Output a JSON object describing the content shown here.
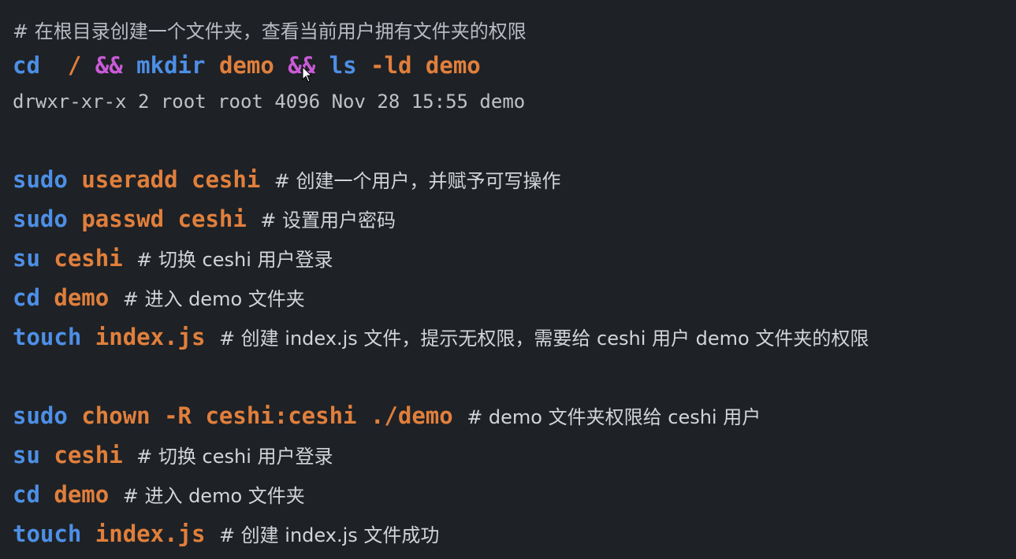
{
  "heading": "# 在根目录创建一个文件夹，查看当前用户拥有文件夹的权限",
  "line1": {
    "cmd1": "cd",
    "slash": "/",
    "op1": "&&",
    "cmd2": "mkdir",
    "arg1": "demo",
    "op2": "&&",
    "cmd3": "ls",
    "flag": "-ld",
    "arg2": "demo"
  },
  "output": "drwxr-xr-x 2 root root 4096 Nov 28 15:55 demo",
  "block1": [
    {
      "cmd": "sudo",
      "args": "useradd ceshi",
      "comment": "# 创建一个用户，并赋予可写操作"
    },
    {
      "cmd": "sudo",
      "args": "passwd ceshi",
      "comment": "# 设置用户密码"
    },
    {
      "cmd": "su",
      "args": "ceshi",
      "comment": "# 切换 ceshi 用户登录"
    },
    {
      "cmd": "cd",
      "args": "demo",
      "comment": "# 进入 demo 文件夹"
    },
    {
      "cmd": "touch",
      "args": "index.js",
      "comment": "# 创建 index.js 文件，提示无权限，需要给 ceshi 用户 demo 文件夹的权限"
    }
  ],
  "block2": [
    {
      "cmd": "sudo",
      "args": "chown -R ceshi:ceshi ./demo",
      "comment": "# demo 文件夹权限给 ceshi 用户"
    },
    {
      "cmd": "su",
      "args": "ceshi",
      "comment": "# 切换 ceshi 用户登录"
    },
    {
      "cmd": "cd",
      "args": "demo",
      "comment": "# 进入 demo 文件夹"
    },
    {
      "cmd": "touch",
      "args": "index.js",
      "comment": "# 创建 index.js 文件成功"
    }
  ],
  "icons": {
    "cursor": "mouse-pointer-icon"
  },
  "colors": {
    "background": "#1e2125",
    "command": "#4d8fe6",
    "argument": "#e07f3c",
    "operator": "#c95bd6",
    "comment": "#d2d4d8"
  }
}
